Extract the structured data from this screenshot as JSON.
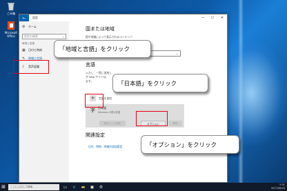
{
  "desktop": {
    "icons": [
      {
        "label": "ごみ箱",
        "icon": "recycle-bin-icon"
      },
      {
        "label": "Microsoft Office",
        "icon": "office-icon"
      }
    ]
  },
  "window": {
    "back_glyph": "←",
    "title": "設定",
    "minimize": "—",
    "maximize": "☐",
    "close": "✕"
  },
  "sidebar": {
    "home": {
      "label": "ホーム",
      "icon": "gear-icon"
    },
    "search_placeholder": "設定の検索",
    "search_icon": "⌕",
    "group_label": "時刻と言語",
    "items": [
      {
        "label": "日付と時刻",
        "icon": "calendar-icon"
      },
      {
        "label": "地域と言語",
        "icon": "region-language-icon"
      },
      {
        "label": "音声認識",
        "icon": "microphone-icon"
      }
    ]
  },
  "main": {
    "region_heading": "国または地域",
    "region_desc": "国や地域によって表示されるコンテンツ",
    "region_dropdown_value": "",
    "chevron": "⌄",
    "language_heading": "言語",
    "language_desc_1": "入力し、一覧に追加し",
    "language_desc_2": "が Web サイトは、",
    "language_desc_3": "ます。",
    "add_language_label": "言語を追加",
    "add_icon": "+",
    "language_item": {
      "glyph": "字",
      "name": "日本語",
      "sub": "Windows の表示言語"
    },
    "buttons": {
      "default": "既定として設定",
      "options": "オプション",
      "remove": "削除"
    },
    "related_heading": "関連設定",
    "related_link": "日付、時刻、地域の追加設定"
  },
  "callouts": {
    "region": "「地域と言語」をクリック",
    "japanese": "「日本語」をクリック",
    "options": "「オプション」をクリック"
  },
  "taskbar": {
    "start_glyph": "⊞",
    "search_placeholder": "ここに入力して検索",
    "time": "2:31",
    "date": "2017/08/09"
  },
  "colors": {
    "accent": "#0063b1",
    "highlight": "#e60012",
    "taskbar": "#101a2a"
  }
}
